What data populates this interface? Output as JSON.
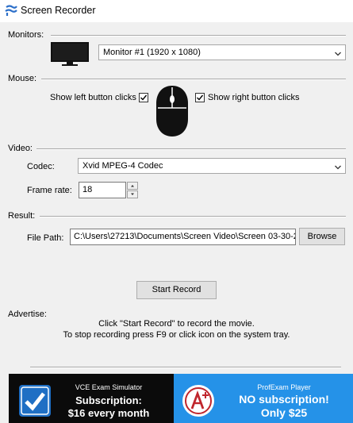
{
  "window": {
    "title": "Screen Recorder"
  },
  "monitors": {
    "label": "Monitors:",
    "selected": "Monitor #1 (1920 x 1080)"
  },
  "mouse": {
    "label": "Mouse:",
    "left_clicks_label": "Show left button clicks",
    "left_checked": true,
    "right_clicks_label": "Show right button clicks",
    "right_checked": true
  },
  "video": {
    "label": "Video:",
    "codec_label": "Codec:",
    "codec_value": "Xvid MPEG-4 Codec",
    "framerate_label": "Frame rate:",
    "framerate_value": "18"
  },
  "result": {
    "label": "Result:",
    "filepath_label": "File Path:",
    "filepath_value": "C:\\Users\\27213\\Documents\\Screen Video\\Screen 03-30-2",
    "browse_label": "Browse"
  },
  "actions": {
    "start_record_label": "Start Record"
  },
  "advertise": {
    "label": "Advertise:",
    "line1": "Click \"Start Record\" to record the movie.",
    "line2": "To stop recording press F9 or click icon on the system tray."
  },
  "ads": {
    "left": {
      "product": "VCE Exam Simulator",
      "line1": "Subscription:",
      "line2": "$16 every month"
    },
    "right": {
      "product": "ProfExam Player",
      "line1": "NO subscription!",
      "line2": "Only $25"
    }
  },
  "colors": {
    "ad_left_bg": "#0b0b0b",
    "ad_right_bg": "#2592e8",
    "ad_check_blue": "#1f6fc4",
    "ad_logo_red": "#c0262d"
  }
}
